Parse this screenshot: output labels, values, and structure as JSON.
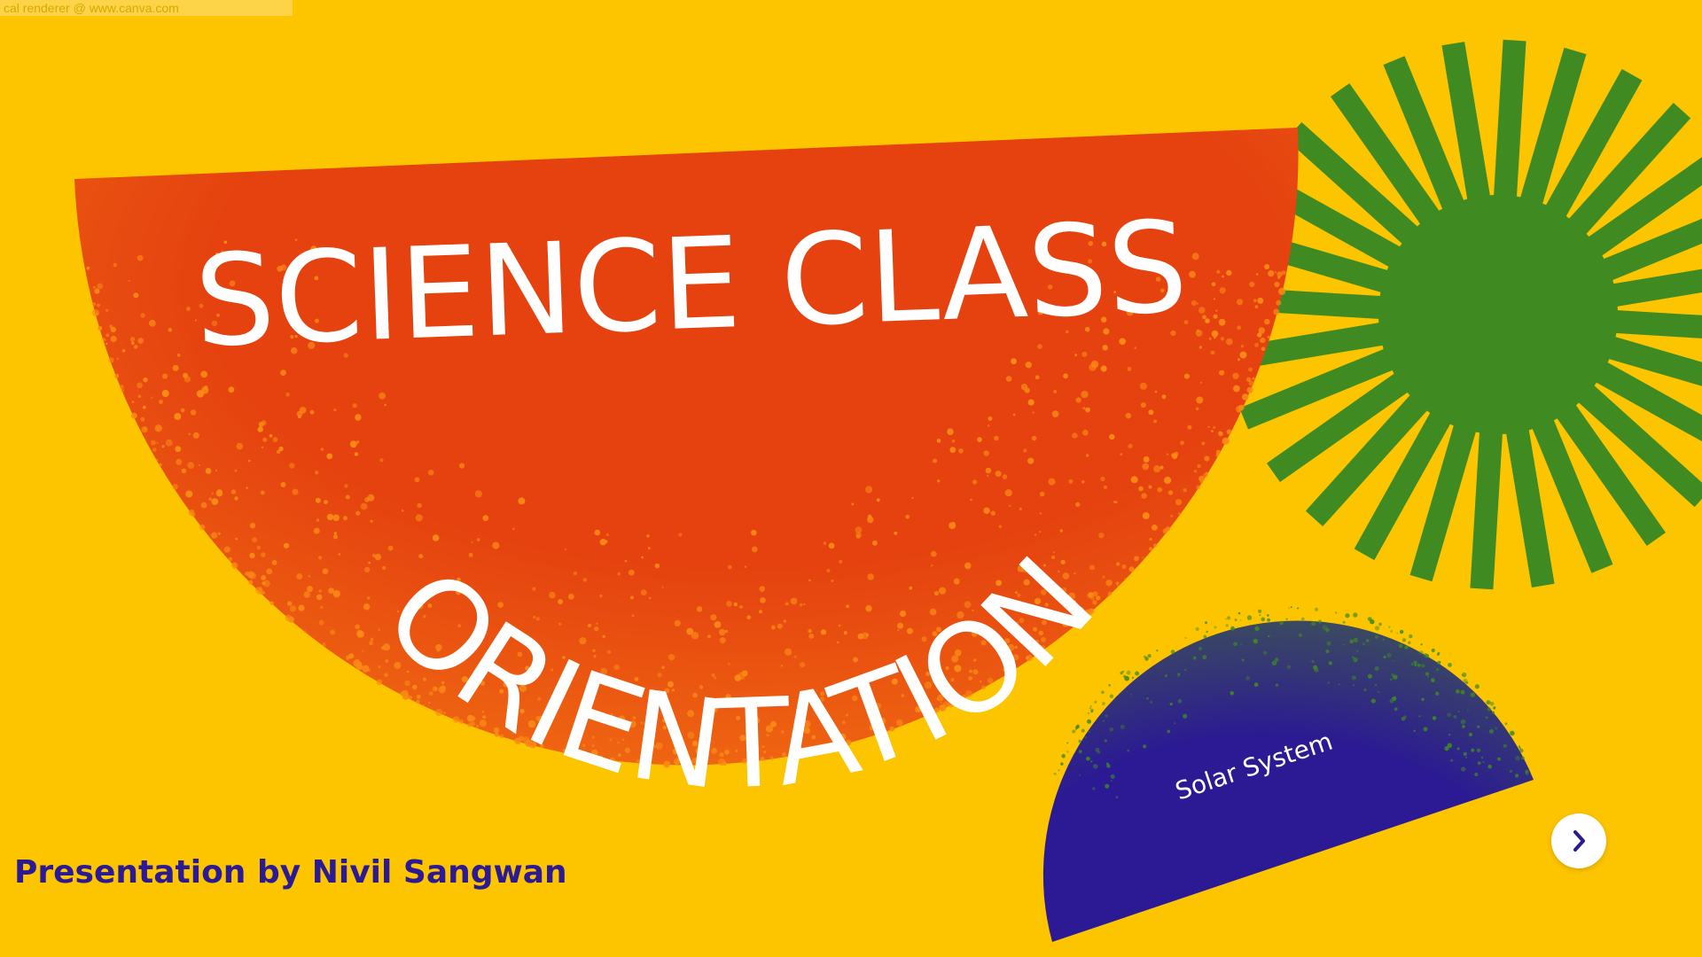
{
  "watermark": "cal renderer @ www.canva.com",
  "slide": {
    "title_line1": "SCIENCE CLASS",
    "title_line2": "ORIENTATION",
    "subtitle": "Solar System",
    "byline": "Presentation by Nivil Sangwan"
  },
  "controls": {
    "next_icon": "chevron-right-icon"
  },
  "colors": {
    "background": "#FDC400",
    "orange": "#E5420F",
    "orange_speckle": "#FA8A15",
    "green": "#3F8B22",
    "navy": "#2B1A93",
    "white": "#FFFFFF",
    "byline": "#2B1A93"
  }
}
